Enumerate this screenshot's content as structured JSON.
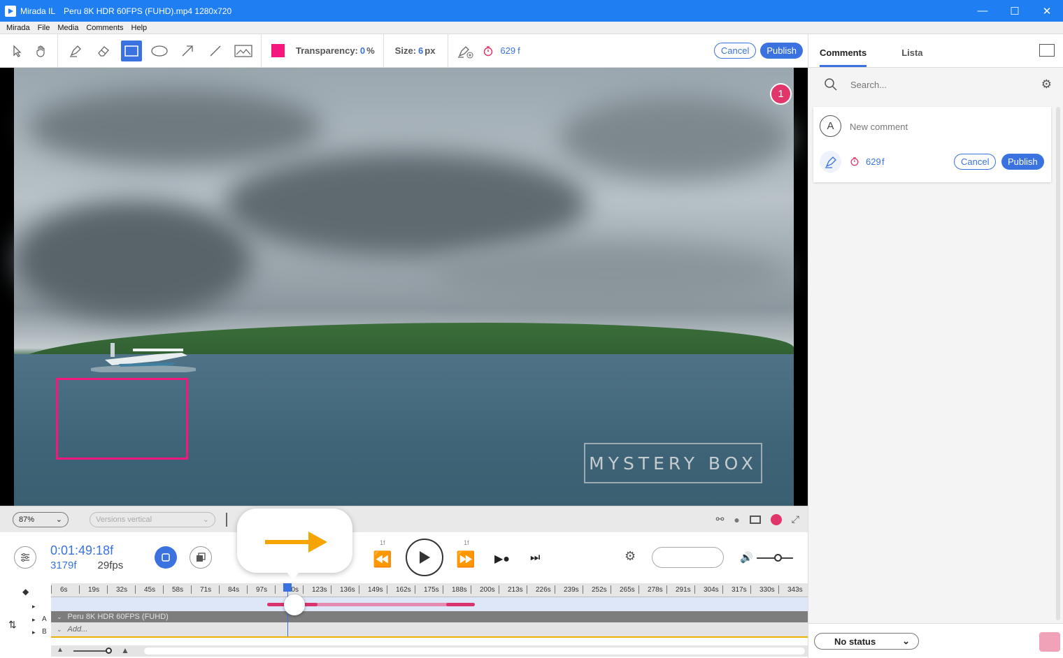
{
  "window": {
    "app": "Mirada IL",
    "file": "Peru 8K HDR 60FPS (FUHD).mp4 1280x720",
    "minimize": "—",
    "maximize": "☐",
    "close": "✕"
  },
  "menu": [
    "Mirada",
    "File",
    "Media",
    "Comments",
    "Help"
  ],
  "toolbar": {
    "transparency_label": "Transparency:",
    "transparency_value": "0",
    "transparency_unit": "%",
    "size_label": "Size:",
    "size_value": "6",
    "size_unit": "px",
    "frame_value": "629",
    "frame_unit": "f",
    "cancel": "Cancel",
    "publish": "Publish",
    "color": "#f4177c"
  },
  "video": {
    "marker": "1",
    "watermark": "MYSTERY BOX"
  },
  "viewbar": {
    "zoom": "87%",
    "versions": "Versions vertical"
  },
  "controls": {
    "timecode": "0:01:49:18f",
    "frames": "3179f",
    "fps": "29fps",
    "step_back": "1f",
    "step_fwd": "1f"
  },
  "timeline": {
    "ticks": [
      "6s",
      "19s",
      "32s",
      "45s",
      "58s",
      "71s",
      "84s",
      "97s",
      "110s",
      "123s",
      "136s",
      "149s",
      "162s",
      "175s",
      "188s",
      "200s",
      "213s",
      "226s",
      "239s",
      "252s",
      "265s",
      "278s",
      "291s",
      "304s",
      "317s",
      "330s",
      "343s"
    ],
    "track_a": "Peru 8K HDR 60FPS (FUHD)",
    "track_b": "Add...",
    "label_a": "A",
    "label_b": "B"
  },
  "panel": {
    "tab_comments": "Comments",
    "tab_lista": "Lista",
    "search_placeholder": "Search...",
    "avatar": "A",
    "new_comment": "New comment",
    "frame_value": "629",
    "frame_unit": "f",
    "cancel": "Cancel",
    "publish": "Publish",
    "status": "No status"
  }
}
